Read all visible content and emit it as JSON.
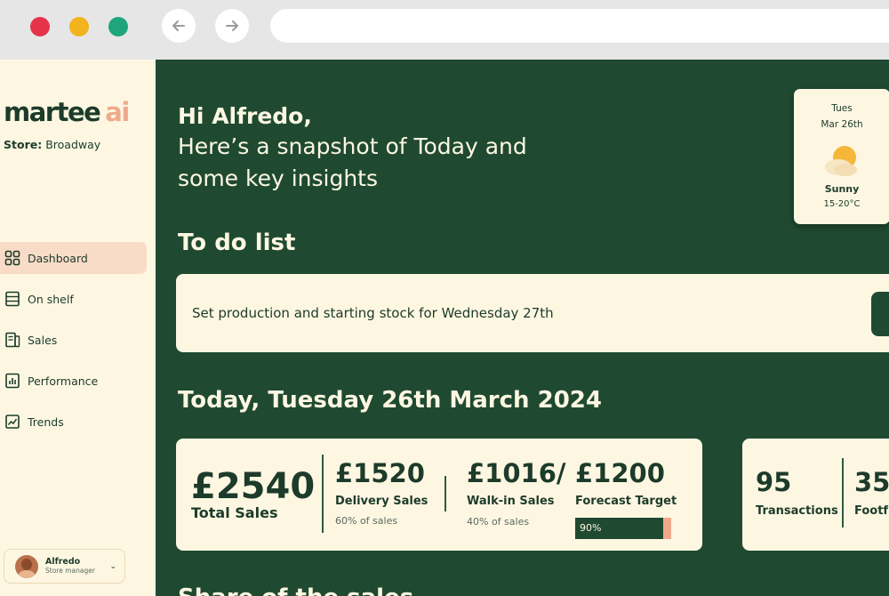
{
  "brand": {
    "name": "martee",
    "suffix": "ai"
  },
  "store": {
    "label": "Store:",
    "name": "Broadway"
  },
  "nav": [
    {
      "label": "Dashboard",
      "icon": "dashboard-grid-icon",
      "active": true
    },
    {
      "label": "On shelf",
      "icon": "shelf-icon",
      "active": false
    },
    {
      "label": "Sales",
      "icon": "sales-icon",
      "active": false
    },
    {
      "label": "Performance",
      "icon": "performance-icon",
      "active": false
    },
    {
      "label": "Trends",
      "icon": "trends-icon",
      "active": false
    }
  ],
  "user": {
    "name": "Alfredo",
    "role": "Store manager"
  },
  "greeting": {
    "name": "Hi Alfredo,",
    "line1": "Here’s a snapshot of Today and",
    "line2": "some key insights"
  },
  "weather": {
    "day": "Tues",
    "date": "Mar 26th",
    "condition": "Sunny",
    "temp": "15-20°C",
    "icon": "sun-cloud-icon"
  },
  "todo": {
    "title": "To do list",
    "items": [
      {
        "text": "Set production and starting stock for Wednesday 27th"
      }
    ]
  },
  "today": {
    "title": "Today, Tuesday 26th March 2024",
    "total_sales": {
      "value": "£2540",
      "label": "Total Sales"
    },
    "delivery": {
      "value": "£1520",
      "label": "Delivery Sales",
      "sub": "60% of sales"
    },
    "walkin": {
      "value": "£1016/",
      "label": "Walk-in Sales",
      "sub": "40% of sales"
    },
    "forecast": {
      "value": "£1200",
      "label": "Forecast Target",
      "progress_label": "90%",
      "progress": 0.9
    },
    "transactions": {
      "value": "95",
      "label": "Transactions"
    },
    "footfall": {
      "value": "35",
      "label": "Footf"
    }
  },
  "bottom_section_title": "Share of the sales",
  "colors": {
    "dark_green": "#1f4a31",
    "cream": "#fdf7e2",
    "peach": "#f0a98c",
    "text": "#1d3b2a"
  }
}
